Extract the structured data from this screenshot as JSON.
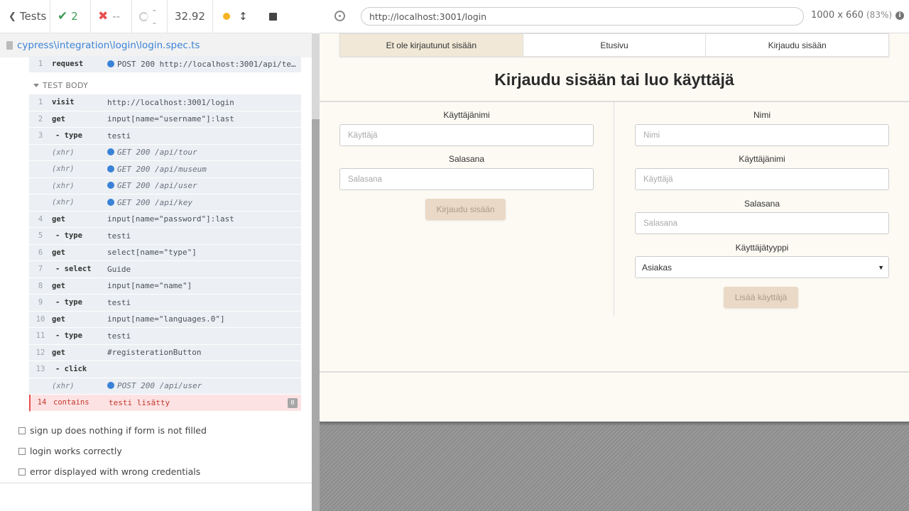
{
  "reporter": {
    "tests_label": "Tests",
    "passed_count": "2",
    "failed_count": "--",
    "pending_count": "--",
    "duration": "32.92",
    "spec_path": "cypress\\integration\\login\\login.spec.ts",
    "before_command": {
      "num": "1",
      "name": "request",
      "msg": "POST 200 http://localhost:3001/api/testing/reset"
    },
    "test_body_label": "TEST BODY",
    "commands": [
      {
        "num": "1",
        "name": "visit",
        "msg": "http://localhost:3001/login",
        "kind": "cmd"
      },
      {
        "num": "2",
        "name": "get",
        "msg": "input[name=\"username\"]:last",
        "kind": "cmd"
      },
      {
        "num": "3",
        "name": "- type",
        "msg": "testi",
        "kind": "child"
      },
      {
        "num": "",
        "name": "(xhr)",
        "msg": "GET 200 /api/tour",
        "kind": "xhr"
      },
      {
        "num": "",
        "name": "(xhr)",
        "msg": "GET 200 /api/museum",
        "kind": "xhr"
      },
      {
        "num": "",
        "name": "(xhr)",
        "msg": "GET 200 /api/user",
        "kind": "xhr"
      },
      {
        "num": "",
        "name": "(xhr)",
        "msg": "GET 200 /api/key",
        "kind": "xhr"
      },
      {
        "num": "4",
        "name": "get",
        "msg": "input[name=\"password\"]:last",
        "kind": "cmd"
      },
      {
        "num": "5",
        "name": "- type",
        "msg": "testi",
        "kind": "child"
      },
      {
        "num": "6",
        "name": "get",
        "msg": "select[name=\"type\"]",
        "kind": "cmd"
      },
      {
        "num": "7",
        "name": "- select",
        "msg": "Guide",
        "kind": "child"
      },
      {
        "num": "8",
        "name": "get",
        "msg": "input[name=\"name\"]",
        "kind": "cmd"
      },
      {
        "num": "9",
        "name": "- type",
        "msg": "testi",
        "kind": "child"
      },
      {
        "num": "10",
        "name": "get",
        "msg": "input[name=\"languages.0\"]",
        "kind": "cmd"
      },
      {
        "num": "11",
        "name": "- type",
        "msg": "testi",
        "kind": "child"
      },
      {
        "num": "12",
        "name": "get",
        "msg": "#registerationButton",
        "kind": "cmd"
      },
      {
        "num": "13",
        "name": "- click",
        "msg": "",
        "kind": "child"
      },
      {
        "num": "",
        "name": "(xhr)",
        "msg": "POST 200 /api/user",
        "kind": "xhr"
      },
      {
        "num": "14",
        "name": "contains",
        "msg": "testi lisätty",
        "kind": "fail",
        "badge": "0"
      }
    ],
    "other_tests": [
      "sign up does nothing if form is not filled",
      "login works correctly",
      "error displayed with wrong credentials"
    ]
  },
  "browser": {
    "url": "http://localhost:3001/login",
    "viewport": "1000 x 660",
    "scale": "(83%)"
  },
  "app": {
    "nav": [
      "Et ole kirjautunut sisään",
      "Etusivu",
      "Kirjaudu sisään"
    ],
    "title": "Kirjaudu sisään tai luo käyttäjä",
    "login": {
      "username_label": "Käyttäjänimi",
      "username_placeholder": "Käyttäjä",
      "password_label": "Salasana",
      "password_placeholder": "Salasana",
      "submit": "Kirjaudu sisään"
    },
    "register": {
      "name_label": "Nimi",
      "name_placeholder": "Nimi",
      "username_label": "Käyttäjänimi",
      "username_placeholder": "Käyttäjä",
      "password_label": "Salasana",
      "password_placeholder": "Salasana",
      "type_label": "Käyttäjätyyppi",
      "type_value": "Asiakas",
      "submit": "Lisää käyttäjä"
    }
  },
  "colors": {
    "passed": "#3e9b56",
    "failed": "#e94f4f",
    "link": "#3a82d6",
    "app_bg": "#fcfaf3",
    "button_bg": "#ead9c6"
  }
}
